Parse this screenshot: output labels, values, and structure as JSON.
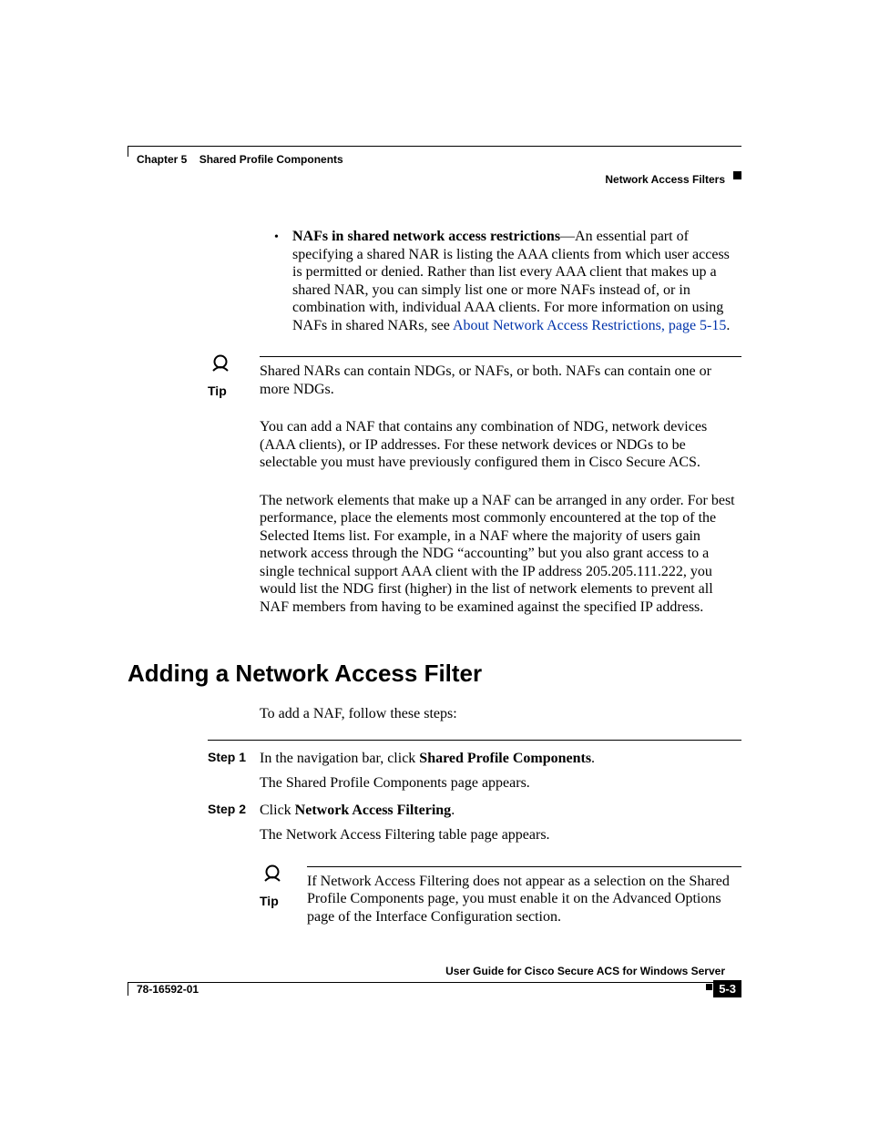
{
  "header": {
    "chapter_label": "Chapter 5",
    "chapter_title": "Shared Profile Components",
    "section_title": "Network Access Filters"
  },
  "bullet": {
    "lead": "NAFs in shared network access restrictions",
    "body": "—An essential part of specifying a shared NAR is listing the AAA clients from which user access is permitted or denied. Rather than list every AAA client that makes up a shared NAR, you can simply list one or more NAFs instead of, or in combination with, individual AAA clients. For more information on using NAFs in shared NARs, see ",
    "link": "About Network Access Restrictions, page 5-15",
    "after_link": "."
  },
  "tip1": {
    "label": "Tip",
    "text": "Shared NARs can contain NDGs, or NAFs, or both. NAFs can contain one or more NDGs."
  },
  "para1": "You can add a NAF that contains any combination of NDG, network devices (AAA clients), or IP addresses. For these network devices or NDGs to be selectable you must have previously configured them in Cisco Secure ACS.",
  "para2": "The network elements that make up a NAF can be arranged in any order. For best performance, place the elements most commonly encountered at the top of the Selected Items list. For example, in a NAF where the majority of users gain network access through the NDG “accounting” but you also grant access to a single technical support AAA client with the IP address 205.205.111.222, you would list the NDG first (higher) in the list of network elements to prevent all NAF members from having to be examined against the specified IP address.",
  "heading": "Adding a Network Access Filter",
  "intro": "To add a NAF, follow these steps:",
  "steps": {
    "s1_label": "Step 1",
    "s1_line1_pre": "In the navigation bar, click ",
    "s1_line1_bold": "Shared Profile Components",
    "s1_line1_post": ".",
    "s1_line2": "The Shared Profile Components page appears.",
    "s2_label": "Step 2",
    "s2_line1_pre": "Click ",
    "s2_line1_bold": "Network Access Filtering",
    "s2_line1_post": ".",
    "s2_line2": "The Network Access Filtering table page appears."
  },
  "tip2": {
    "label": "Tip",
    "text": "If Network Access Filtering does not appear as a selection on the Shared Profile Components page, you must enable it on the Advanced Options page of the Interface Configuration section."
  },
  "footer": {
    "guide_title": "User Guide for Cisco Secure ACS for Windows Server",
    "doc_number": "78-16592-01",
    "page_number": "5-3"
  }
}
